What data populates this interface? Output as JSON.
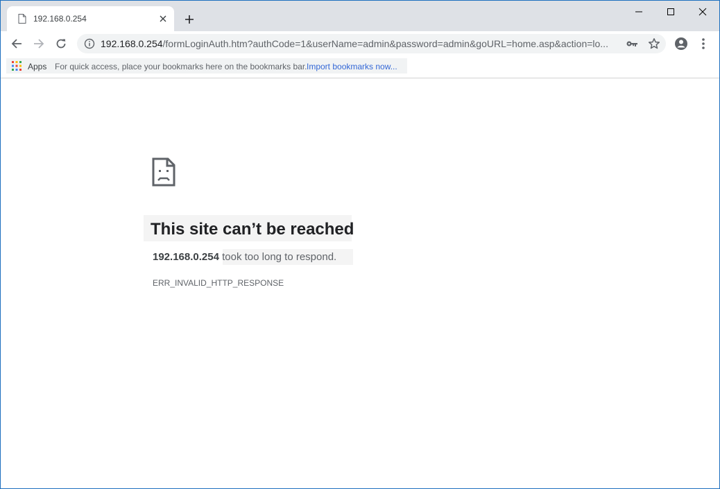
{
  "tab": {
    "title": "192.168.0.254",
    "close_icon": "close-icon",
    "favicon": "page-icon"
  },
  "new_tab_icon": "plus-icon",
  "window_controls": {
    "minimize_icon": "minimize-icon",
    "maximize_icon": "maximize-icon",
    "close_icon": "close-icon"
  },
  "toolbar": {
    "back_icon": "arrow-left-icon",
    "forward_icon": "arrow-right-icon",
    "reload_icon": "reload-icon",
    "url_host": "192.168.0.254",
    "url_path": "/formLoginAuth.htm?authCode=1&userName=admin&password=admin&goURL=home.asp&action=lo...",
    "info_icon": "info-icon",
    "key_icon": "key-icon",
    "bookmark_icon": "star-icon",
    "profile_icon": "account-icon",
    "menu_icon": "more-vertical-icon"
  },
  "bookmarks_bar": {
    "apps_label": "Apps",
    "hint": "For quick access, place your bookmarks here on the bookmarks bar.",
    "import_link": "Import bookmarks now..."
  },
  "error": {
    "heading": "This site can’t be reached",
    "host": "192.168.0.254",
    "message": " took too long to respond.",
    "code": "ERR_INVALID_HTTP_RESPONSE"
  },
  "colors": {
    "tabstrip": "#dee1e6",
    "omnibox": "#f1f3f4",
    "link": "#3367d6",
    "window_border": "#1c6fbf"
  }
}
